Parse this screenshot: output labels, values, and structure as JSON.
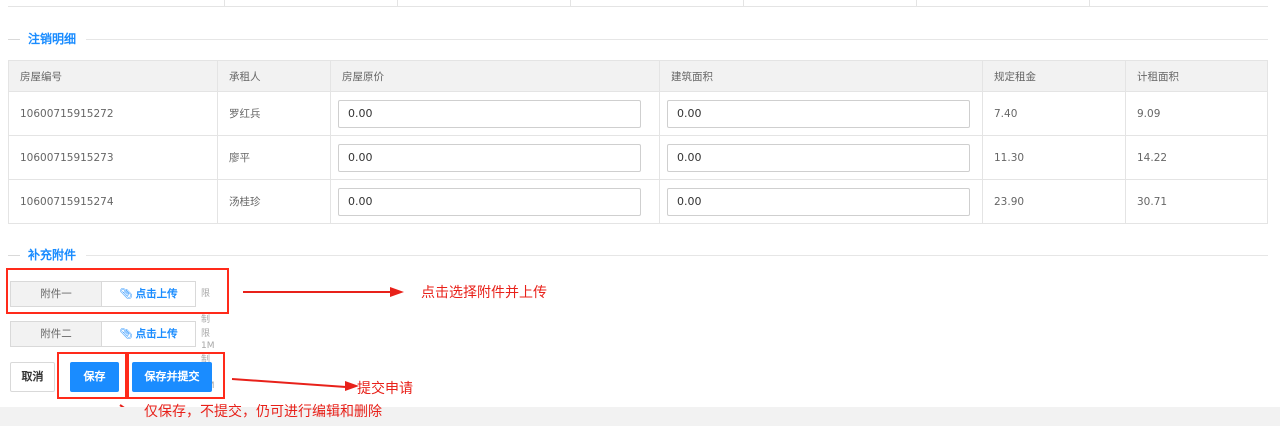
{
  "sections": {
    "cancel_detail_title": "注销明细",
    "attachments_title": "补充附件"
  },
  "table": {
    "headers": [
      "房屋编号",
      "承租人",
      "房屋原价",
      "建筑面积",
      "规定租金",
      "计租面积"
    ],
    "rows": [
      {
        "house_no": "10600715915272",
        "tenant": "罗红兵",
        "original_price": "0.00",
        "floor_area": "0.00",
        "rent": "7.40",
        "rent_area": "9.09"
      },
      {
        "house_no": "10600715915273",
        "tenant": "廖平",
        "original_price": "0.00",
        "floor_area": "0.00",
        "rent": "11.30",
        "rent_area": "14.22"
      },
      {
        "house_no": "10600715915274",
        "tenant": "汤桂珍",
        "original_price": "0.00",
        "floor_area": "0.00",
        "rent": "23.90",
        "rent_area": "30.71"
      }
    ]
  },
  "attachments": [
    {
      "name": "附件一",
      "upload_label": "点击上传",
      "limit": "限制1M"
    },
    {
      "name": "附件二",
      "upload_label": "点击上传",
      "limit": "限制1M"
    }
  ],
  "buttons": {
    "cancel": "取消",
    "save": "保存",
    "save_submit": "保存并提交"
  },
  "annotations": {
    "upload_note": "点击选择附件并上传",
    "submit_note": "提交申请",
    "save_note": "仅保存，不提交，仍可进行编辑和删除"
  },
  "colors": {
    "accent": "#1a8cff",
    "annotation_red": "#e8211a"
  }
}
